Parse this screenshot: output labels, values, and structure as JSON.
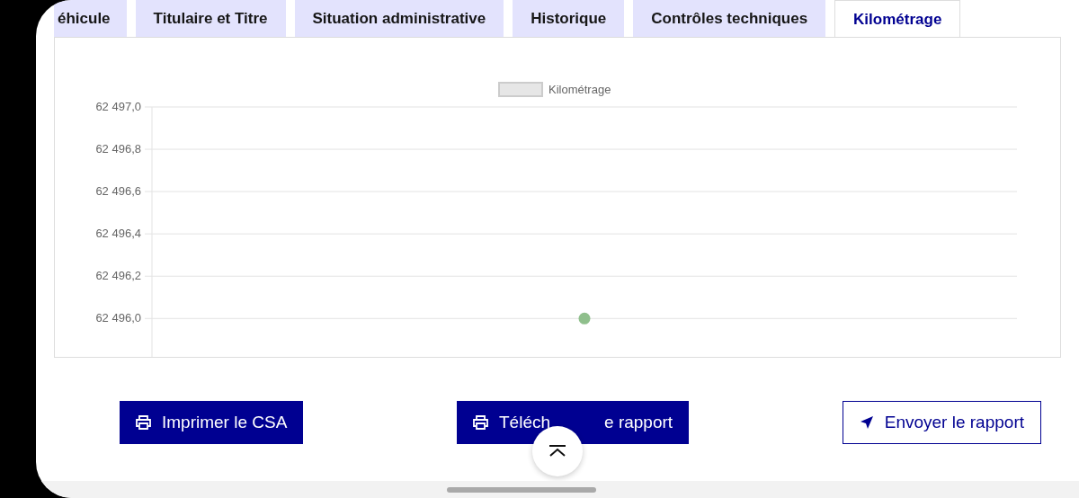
{
  "tabs": [
    {
      "label": "éhicule",
      "selected": false
    },
    {
      "label": "Titulaire et Titre",
      "selected": false
    },
    {
      "label": "Situation administrative",
      "selected": false
    },
    {
      "label": "Historique",
      "selected": false
    },
    {
      "label": "Contrôles techniques",
      "selected": false
    },
    {
      "label": "Kilométrage",
      "selected": true
    }
  ],
  "chart": {
    "chart_data": {
      "type": "line",
      "grid": true,
      "categories": [
        null
      ],
      "ylim": [
        62495.81,
        62497.0
      ],
      "yticks": [
        {
          "value": 62496.0,
          "label": "62 496,0"
        },
        {
          "value": 62496.2,
          "label": "62 496,2"
        },
        {
          "value": 62496.4,
          "label": "62 496,4"
        },
        {
          "value": 62496.6,
          "label": "62 496,6"
        },
        {
          "value": 62496.8,
          "label": "62 496,8"
        },
        {
          "value": 62497.0,
          "label": "62 497,0"
        }
      ],
      "series": [
        {
          "name": "Kilométrage",
          "marker": "circle",
          "values": [
            62496.0
          ]
        }
      ]
    }
  },
  "buttons": [
    {
      "kind": "print",
      "label_parts": [
        "Imprimer le CSA"
      ]
    },
    {
      "kind": "print",
      "label_parts": [
        "Téléch",
        "e rapport"
      ]
    },
    {
      "kind": "send",
      "label_parts": [
        "Envoyer le rapport"
      ]
    }
  ]
}
